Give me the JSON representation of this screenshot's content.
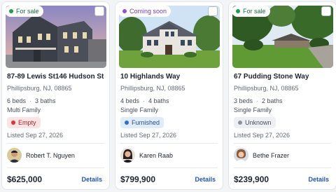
{
  "listings": [
    {
      "badge": "For sale",
      "photo_icon": "house-photo-dark-siding",
      "address": "87-89 Lewis St146 Hudson St",
      "city": "Phillipsburg, NJ, 08865",
      "beds": "6 beds",
      "baths": "3 baths",
      "property_type": "Multi Family",
      "occupancy": "Empty",
      "listed": "Listed Sep 27, 2026",
      "agent": "Robert T. Nguyen",
      "price": "$625,000",
      "details_label": "Details"
    },
    {
      "badge": "Coming soon",
      "photo_icon": "house-photo-colonial",
      "address": "10 Highlands Way",
      "city": "Phillipsburg, NJ, 08865",
      "beds": "4 beds",
      "baths": "4 baths",
      "property_type": "Single Family",
      "occupancy": "Furnished",
      "listed": "Listed Sep 27, 2026",
      "agent": "Karen Raab",
      "price": "$799,900",
      "details_label": "Details"
    },
    {
      "badge": "For sale",
      "photo_icon": "house-photo-wooded-lot",
      "address": "67 Pudding Stone Way",
      "city": "Phillipsburg, NJ, 08865",
      "beds": "3 beds",
      "baths": "2 baths",
      "property_type": "Single Family",
      "occupancy": "Unknown",
      "listed": "Listed Sep 27, 2026",
      "agent": "Bethe Frazer",
      "price": "$239,900",
      "details_label": "Details"
    }
  ],
  "colors": {
    "for_sale": "#1f9d4a",
    "coming_soon": "#9b4fd6",
    "empty": "#d93636",
    "furnished": "#2f6fd1",
    "unknown": "#8d939e",
    "details_link": "#1f55c6"
  }
}
